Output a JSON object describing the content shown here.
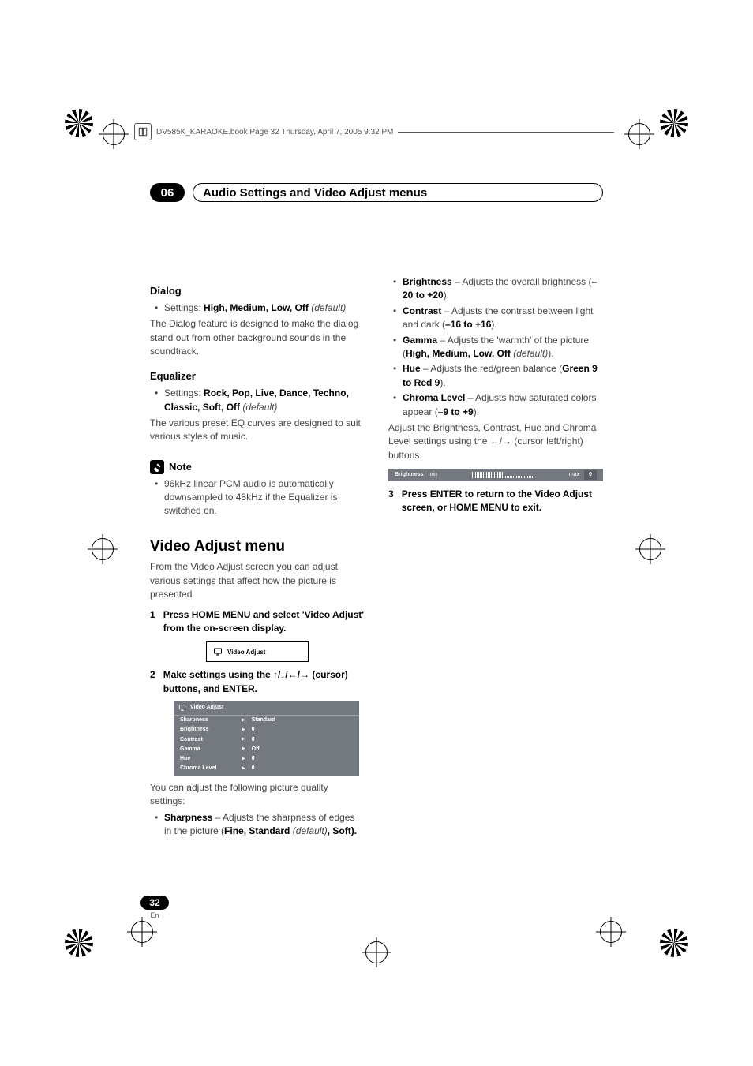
{
  "book_header": {
    "text": "DV585K_KARAOKE.book  Page 32  Thursday, April 7, 2005  9:32 PM"
  },
  "chapter": {
    "num": "06",
    "title": "Audio Settings and Video Adjust menus"
  },
  "left": {
    "dialog": {
      "heading": "Dialog",
      "settings_prefix": "Settings: ",
      "settings_vals": "High, Medium, Low, Off",
      "default": "(default)",
      "body": "The Dialog feature is designed to make the dialog stand out from other background sounds in the soundtrack."
    },
    "eq": {
      "heading": "Equalizer",
      "settings_prefix": "Settings: ",
      "settings_vals": "Rock, Pop, Live, Dance, Techno, Classic, Soft, Off",
      "default": "(default)",
      "body": "The various preset EQ curves are designed to suit various styles of music."
    },
    "note": {
      "label": "Note",
      "text": "96kHz linear PCM audio is automatically downsampled to 48kHz if the Equalizer is switched on."
    },
    "vam": {
      "heading": "Video Adjust menu",
      "intro": "From the Video Adjust screen you can adjust various settings that affect how the picture is presented.",
      "step1_num": "1",
      "step1": "Press HOME MENU and select 'Video Adjust' from the on-screen display.",
      "osd_small_label": "Video Adjust",
      "step2_num": "2",
      "step2a": "Make settings using the ",
      "step2b": " (cursor) buttons, and ENTER.",
      "osd_panel": {
        "title": "Video Adjust",
        "rows": [
          {
            "lbl": "Sharpness",
            "val": "Standard"
          },
          {
            "lbl": "Brightness",
            "val": "0"
          },
          {
            "lbl": "Contrast",
            "val": "0"
          },
          {
            "lbl": "Gamma",
            "val": "Off"
          },
          {
            "lbl": "Hue",
            "val": "0"
          },
          {
            "lbl": "Chroma Level",
            "val": "0"
          }
        ]
      },
      "after_panel": "You can adjust the following picture quality settings:",
      "sharpness_lead": "Sharpness",
      "sharpness_rest": " – Adjusts the sharpness of edges in the picture (",
      "sharpness_vals": "Fine, Standard",
      "sharpness_def": "(default)",
      "sharpness_end": ", Soft)."
    }
  },
  "right": {
    "brightness_lead": "Brightness",
    "brightness_rest": " – Adjusts the overall brightness (",
    "brightness_range": "–20 to +20",
    "close": ").",
    "contrast_lead": "Contrast",
    "contrast_rest": " – Adjusts the contrast between light and dark (",
    "contrast_range": "–16 to +16",
    "gamma_lead": "Gamma",
    "gamma_rest": " – Adjusts the 'warmth' of the picture (",
    "gamma_vals": "High, Medium, Low, Off",
    "gamma_def": "(default)",
    "hue_lead": "Hue",
    "hue_rest": " – Adjusts the red/green balance (",
    "hue_range": "Green 9 to Red 9",
    "chroma_lead": "Chroma Level",
    "chroma_rest": " – Adjusts how saturated colors appear (",
    "chroma_range": "–9 to +9",
    "adjust_para_a": "Adjust the Brightness, Contrast, Hue and Chroma Level settings using the ",
    "adjust_para_b": " (cursor left/right) buttons.",
    "bar": {
      "label": "Brightness",
      "min": "min",
      "max": "max",
      "value": "0"
    },
    "step3_num": "3",
    "step3": "Press ENTER to return to the Video Adjust screen, or HOME MENU to exit."
  },
  "page": {
    "num": "32",
    "lang": "En"
  }
}
